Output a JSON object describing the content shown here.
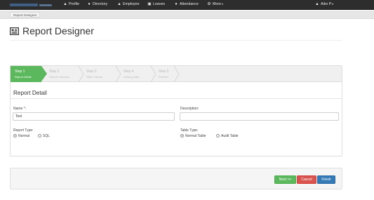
{
  "nav": {
    "items": [
      {
        "label": "Profile",
        "icon": "person-icon"
      },
      {
        "label": "Directory",
        "icon": "users-icon"
      },
      {
        "label": "Employee",
        "icon": "person-icon"
      },
      {
        "label": "Leaves",
        "icon": "camera-icon"
      },
      {
        "label": "Attendance",
        "icon": "clock-icon"
      },
      {
        "label": "More",
        "icon": "gear-icon"
      }
    ],
    "user": {
      "label": "Aiko P",
      "icon": "user-icon"
    }
  },
  "breadcrumb": {
    "current": "Report Designer"
  },
  "page": {
    "title": "Report Designer",
    "title_icon": "report-designer-icon"
  },
  "wizard": {
    "steps": [
      {
        "title": "Step 1",
        "subtitle": "Report Detail",
        "active": true
      },
      {
        "title": "Step 2",
        "subtitle": "Report Columns",
        "active": false
      },
      {
        "title": "Step 3",
        "subtitle": "Filter Criteria",
        "active": false
      },
      {
        "title": "Step 4",
        "subtitle": "Sorting Data",
        "active": false
      },
      {
        "title": "Step 5",
        "subtitle": "Preview",
        "active": false
      }
    ]
  },
  "form": {
    "section_title": "Report Detail",
    "name": {
      "label": "Name *:",
      "value": "Test"
    },
    "description": {
      "label": "Description:",
      "value": ""
    },
    "report_type": {
      "label": "Report Type:",
      "options": [
        {
          "label": "Normal",
          "checked": true
        },
        {
          "label": "SQL",
          "checked": false
        }
      ]
    },
    "table_type": {
      "label": "Table Type:",
      "options": [
        {
          "label": "Normal Table",
          "checked": true
        },
        {
          "label": "Audit Table",
          "checked": false
        }
      ]
    }
  },
  "actions": {
    "next": "Next >>",
    "cancel": "Cancel",
    "finish": "Finish"
  },
  "colors": {
    "topbar": "#2d2d2d",
    "active_step": "#5cb85c",
    "next": "#5cb85c",
    "cancel": "#d9534f",
    "finish": "#337ab7"
  }
}
